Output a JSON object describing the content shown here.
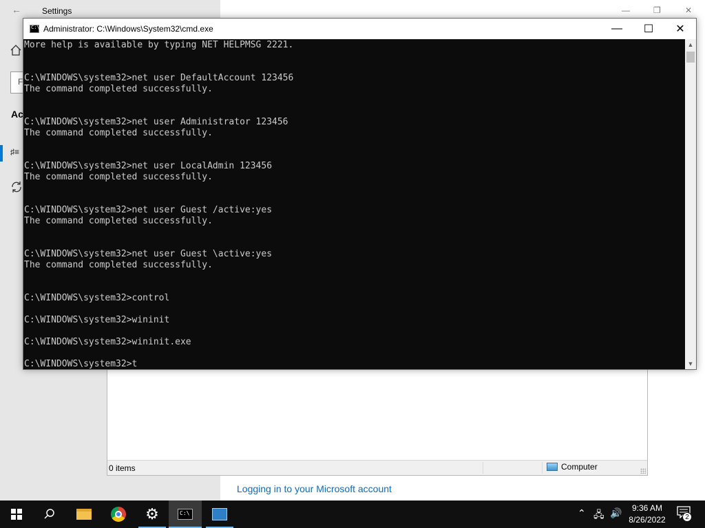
{
  "settings": {
    "title": "Settings",
    "section_heading": "Ac",
    "search_glyph": "F",
    "link": "Logging in to your Microsoft account"
  },
  "explorer": {
    "status_count": "0 items",
    "status_zone": "Computer"
  },
  "cmd": {
    "title": "Administrator: C:\\Windows\\System32\\cmd.exe",
    "icon_text": "C:\\",
    "lines": [
      "More help is available by typing NET HELPMSG 2221.",
      "C:\\WINDOWS\\system32>net user DefaultAccount 123456",
      "The command completed successfully.",
      "C:\\WINDOWS\\system32>net user Administrator 123456",
      "The command completed successfully.",
      "C:\\WINDOWS\\system32>net user LocalAdmin 123456",
      "The command completed successfully.",
      "C:\\WINDOWS\\system32>net user Guest /active:yes",
      "The command completed successfully.",
      "C:\\WINDOWS\\system32>net user Guest \\active:yes",
      "The command completed successfully.",
      "C:\\WINDOWS\\system32>control",
      "C:\\WINDOWS\\system32>wininit",
      "C:\\WINDOWS\\system32>wininit.exe",
      "C:\\WINDOWS\\system32>t"
    ]
  },
  "taskbar": {
    "clock_time": "9:36 AM",
    "clock_date": "8/26/2022",
    "notification_count": "2",
    "items": [
      "start-icon",
      "search-icon",
      "file-explorer-icon",
      "chrome-icon",
      "settings-gear-icon",
      "cmd-icon",
      "control-panel-icon"
    ]
  },
  "colors": {
    "console_bg": "#0c0c0c",
    "console_fg": "#cccccc",
    "taskbar_bg": "#101010",
    "accent": "#0078d7",
    "link": "#0a6cc4"
  }
}
